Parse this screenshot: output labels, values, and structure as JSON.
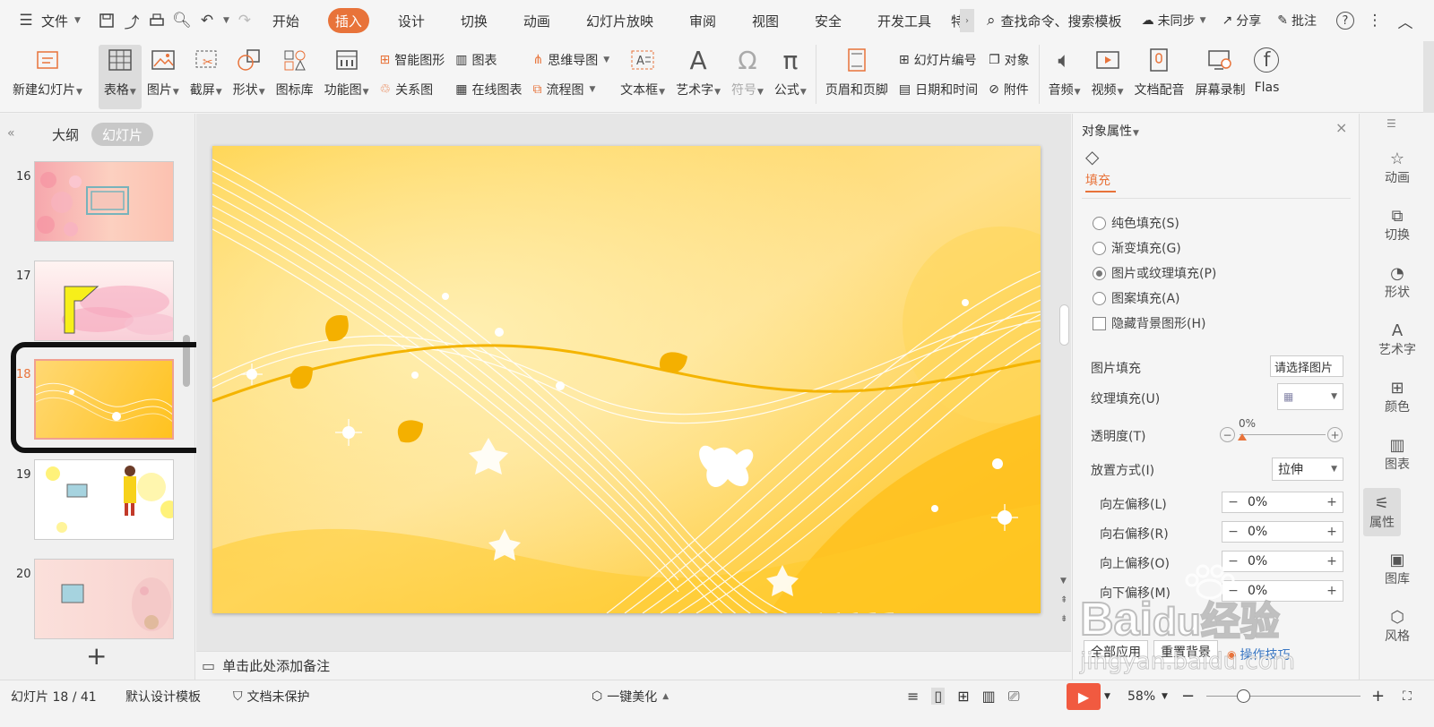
{
  "menu": {
    "file_label": "文件",
    "tabs": [
      "开始",
      "插入",
      "设计",
      "切换",
      "动画",
      "幻灯片放映",
      "审阅",
      "视图",
      "安全",
      "开发工具",
      "特"
    ],
    "active_tab": "插入",
    "search": "查找命令、搜索模板",
    "sync": "未同步",
    "share": "分享",
    "comment": "批注"
  },
  "ribbon": {
    "new_slide": "新建幻灯片",
    "table": "表格",
    "picture": "图片",
    "screenshot": "截屏",
    "shape": "形状",
    "icon_lib": "图标库",
    "func_chart": "功能图",
    "smart_art": "智能图形",
    "chart": "图表",
    "mind_map": "思维导图",
    "relation": "关系图",
    "online_chart": "在线图表",
    "flowchart": "流程图",
    "textbox": "文本框",
    "art_text": "艺术字",
    "symbol": "符号",
    "formula": "公式",
    "header_footer": "页眉和页脚",
    "slide_num": "幻灯片编号",
    "object": "对象",
    "date_time": "日期和时间",
    "attachment": "附件",
    "audio": "音频",
    "video": "视频",
    "doc_dub": "文档配音",
    "screen_rec": "屏幕录制",
    "flash": "Flas"
  },
  "left_panel": {
    "outline_tab": "大纲",
    "slides_tab": "幻灯片",
    "thumbs": [
      {
        "num": "16"
      },
      {
        "num": "17"
      },
      {
        "num": "18"
      },
      {
        "num": "19"
      },
      {
        "num": "20"
      }
    ],
    "add_label": "+"
  },
  "notes": {
    "placeholder": "单击此处添加备注"
  },
  "props": {
    "title": "对象属性",
    "fill_tab": "填充",
    "solid": "纯色填充(S)",
    "gradient": "渐变填充(G)",
    "picture": "图片或纹理填充(P)",
    "pattern": "图案填充(A)",
    "hide_bg": "隐藏背景图形(H)",
    "pic_fill": "图片填充",
    "pic_fill_btn": "请选择图片",
    "texture_fill": "纹理填充(U)",
    "transparency": "透明度(T)",
    "transparency_value": "0%",
    "placement": "放置方式(I)",
    "placement_value": "拉伸",
    "off_left": "向左偏移(L)",
    "off_right": "向右偏移(R)",
    "off_top": "向上偏移(O)",
    "off_bottom": "向下偏移(M)",
    "offset_value": "0%",
    "apply_all": "全部应用",
    "reset_bg": "重置背景",
    "tips": "操作技巧"
  },
  "side_icons": [
    "动画",
    "切换",
    "形状",
    "艺术字",
    "颜色",
    "图表",
    "属性",
    "图库",
    "风格"
  ],
  "status": {
    "slide_pos": "幻灯片 18 / 41",
    "template": "默认设计模板",
    "protect": "文档未保护",
    "beautify": "一键美化",
    "zoom": "58%"
  },
  "watermark": {
    "brand": "Bai",
    "brand_tail": "du",
    "brand_cn": "经验",
    "url": "jingyan.baidu.com"
  },
  "colors": {
    "accent": "#e8733a",
    "slide_yellow": "#ffc41a",
    "play_red": "#f15a40"
  }
}
